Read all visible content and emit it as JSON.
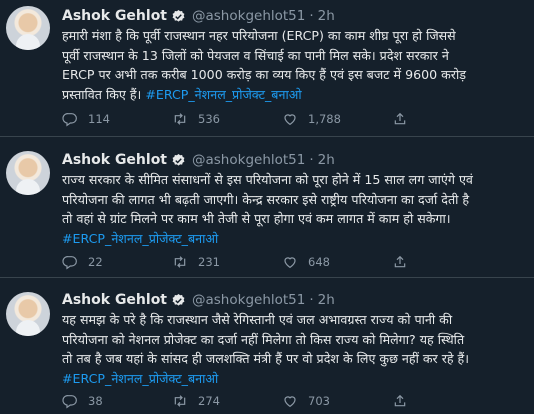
{
  "tweets": [
    {
      "author_name": "Ashok Gehlot",
      "handle": "@ashokgehlot51",
      "separator": "·",
      "time": "2h",
      "text_lines": [
        "हमारी मंशा है कि पूर्वी राजस्थान नहर परियोजना (ERCP) का काम शीघ्र पूरा हो जिससे",
        "पूर्वी राजस्थान के 13 जिलों को पेयजल व सिंचाई का पानी मिल सके। प्रदेश सरकार ने",
        "ERCP पर अभी तक करीब 1000 करोड़ का व्यय किए हैं एवं इस बजट में 9600 करोड़",
        "प्रस्तावित किए हैं।"
      ],
      "hashtag": "#ERCP_नेशनल_प्रोजेक्ट_बनाओ",
      "replies": "114",
      "retweets": "536",
      "likes": "1,788"
    },
    {
      "author_name": "Ashok Gehlot",
      "handle": "@ashokgehlot51",
      "separator": "·",
      "time": "2h",
      "text_lines": [
        "राज्य सरकार के सीमित संसाधनों से इस परियोजना को पूरा होने में 15 साल लग जाएंगे एवं",
        "परियोजना की लागत भी बढ़ती जाएगी। केन्द्र सरकार इसे राष्ट्रीय परियोजना का दर्जा देती है",
        "तो वहां से ग्रांट मिलने पर काम भी तेजी से पूरा होगा एवं कम लागत में काम हो सकेगा।"
      ],
      "hashtag": "#ERCP_नेशनल_प्रोजेक्ट_बनाओ",
      "replies": "22",
      "retweets": "231",
      "likes": "648"
    },
    {
      "author_name": "Ashok Gehlot",
      "handle": "@ashokgehlot51",
      "separator": "·",
      "time": "2h",
      "text_lines": [
        "यह समझ के परे है कि राजस्थान जैसे रेगिस्तानी एवं जल अभावग्रस्त राज्य को पानी की",
        "परियोजना को नेशनल प्रोजेक्ट का दर्जा नहीं मिलेगा तो किस राज्य को मिलेगा? यह स्थिति",
        "तो तब है जब यहां के सांसद ही जलशक्ति मंत्री हैं पर वो प्रदेश के लिए कुछ नहीं कर रहे हैं।"
      ],
      "hashtag": "#ERCP_नेशनल_प्रोजेक्ट_बनाओ",
      "replies": "38",
      "retweets": "274",
      "likes": "703"
    }
  ],
  "icons": {
    "verified": "verified-badge-icon",
    "reply": "reply-icon",
    "retweet": "retweet-icon",
    "like": "like-icon",
    "share": "share-icon"
  },
  "colors": {
    "background": "#15202b",
    "text": "#e7e9ea",
    "secondary": "#8b98a5",
    "link": "#1d9bf0",
    "divider": "#38444d"
  }
}
